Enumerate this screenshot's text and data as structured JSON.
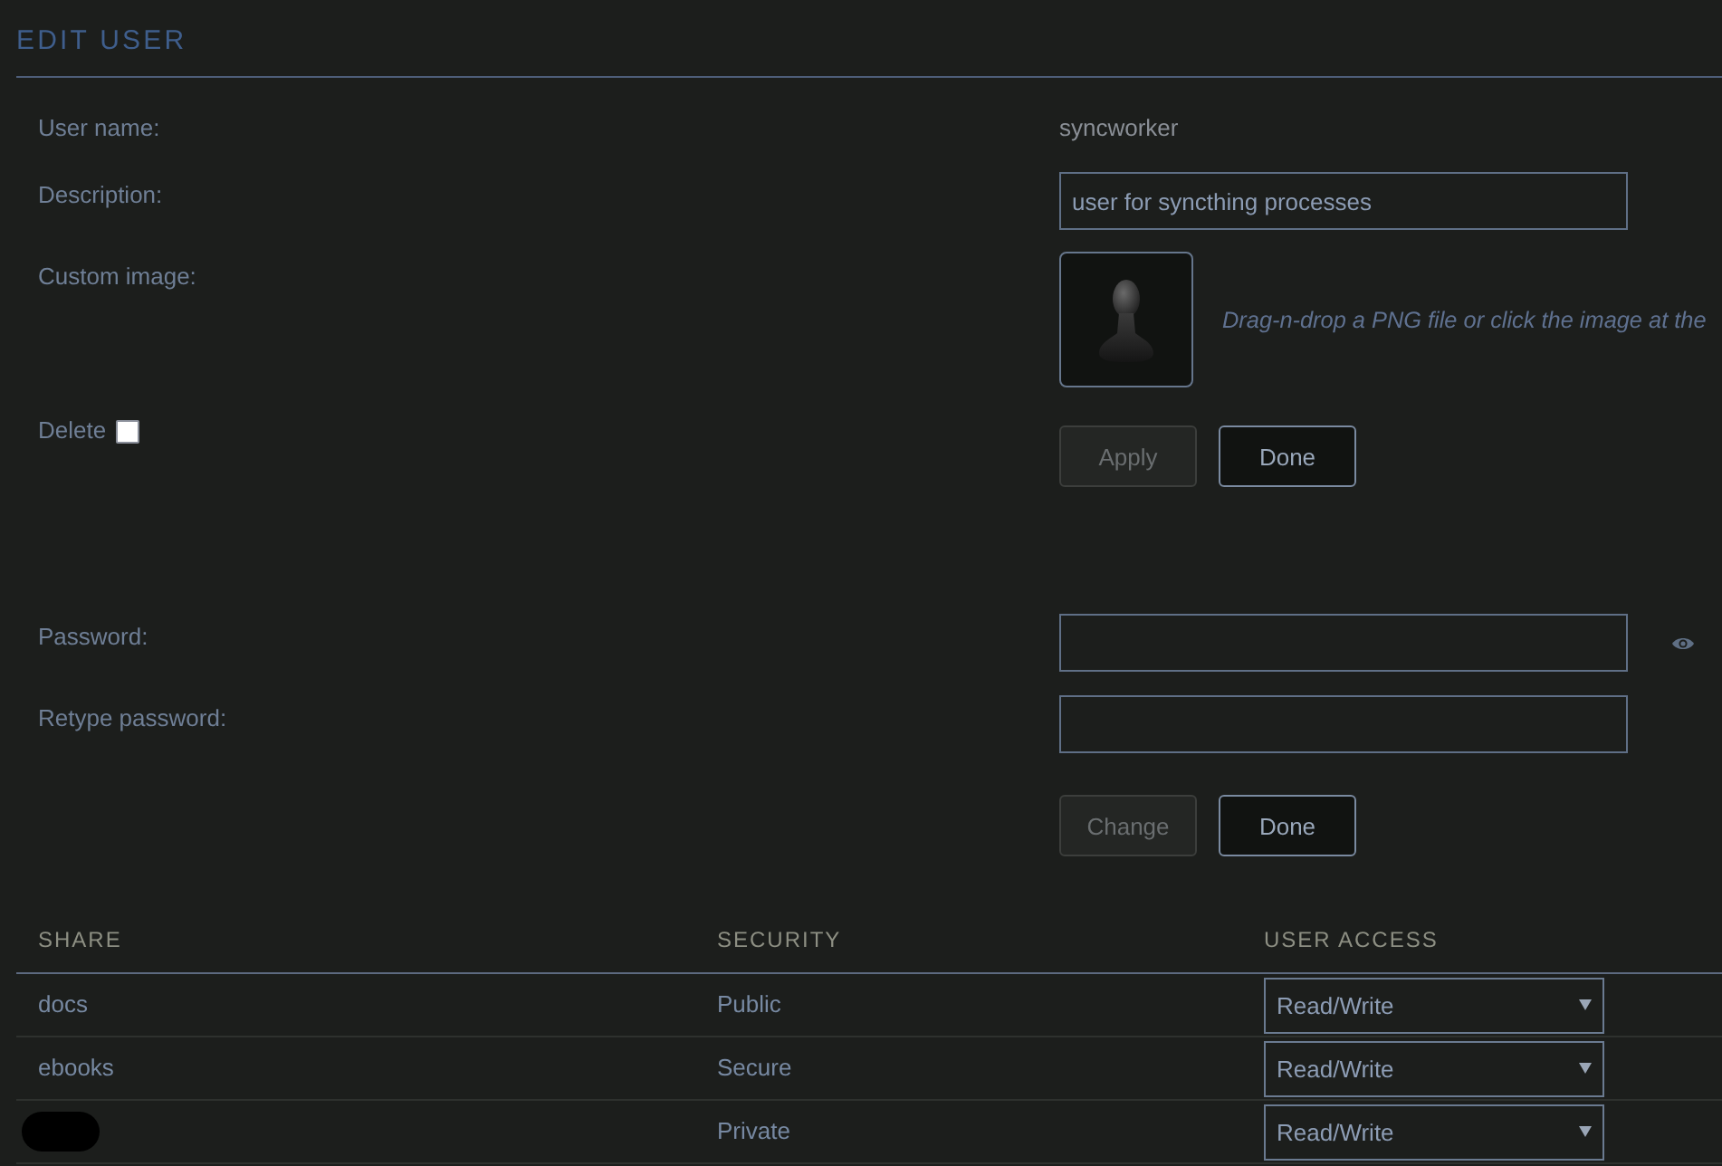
{
  "header": {
    "title": "EDIT USER"
  },
  "form": {
    "user_name": {
      "label": "User name:",
      "value": "syncworker"
    },
    "description": {
      "label": "Description:",
      "value": "user for syncthing processes"
    },
    "custom_image": {
      "label": "Custom image:",
      "hint": "Drag-n-drop a PNG file or click the image at the"
    },
    "delete": {
      "label": "Delete",
      "checked": false
    },
    "buttons": [
      {
        "label": "Apply",
        "disabled": true
      },
      {
        "label": "Done",
        "disabled": false
      }
    ]
  },
  "password": {
    "password": {
      "label": "Password:"
    },
    "retype": {
      "label": "Retype password:"
    },
    "buttons": [
      {
        "label": "Change",
        "disabled": true
      },
      {
        "label": "Done",
        "disabled": false
      }
    ]
  },
  "table": {
    "columns": [
      "SHARE",
      "SECURITY",
      "USER ACCESS"
    ],
    "rows": [
      {
        "share": "docs",
        "redacted": false,
        "security": "Public",
        "access": "Read/Write"
      },
      {
        "share": "ebooks",
        "redacted": false,
        "security": "Secure",
        "access": "Read/Write"
      },
      {
        "redacted": true,
        "security": "Private",
        "access": "Read/Write"
      }
    ]
  }
}
